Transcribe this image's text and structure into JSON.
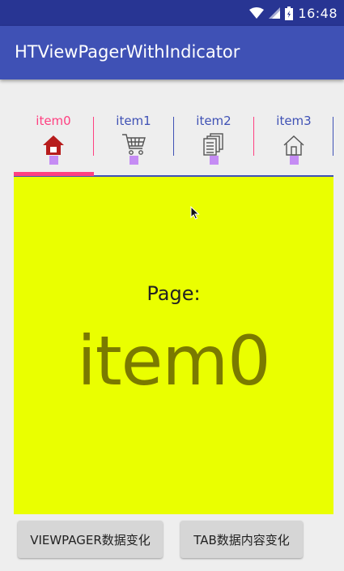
{
  "status_bar": {
    "time": "16:48",
    "icons": [
      "wifi-icon",
      "signal-icon",
      "battery-icon"
    ]
  },
  "app_bar": {
    "title": "HTViewPagerWithIndicator",
    "color": "#3f51b5"
  },
  "tabs": [
    {
      "label": "item0",
      "icon": "home-filled-icon",
      "selected": true
    },
    {
      "label": "item1",
      "icon": "cart-icon",
      "selected": false
    },
    {
      "label": "item2",
      "icon": "documents-icon",
      "selected": false
    },
    {
      "label": "item3",
      "icon": "home-outline-icon",
      "selected": false
    }
  ],
  "colors": {
    "accent": "#ff4081",
    "tab_text": "#3f51b5",
    "page_background": "#eaff00",
    "dot": "#c58cf4"
  },
  "page": {
    "caption": "Page:",
    "title": "item0"
  },
  "buttons": {
    "viewpager_change": "VIEWPAGER数据变化",
    "tab_content_change": "TAB数据内容变化"
  }
}
